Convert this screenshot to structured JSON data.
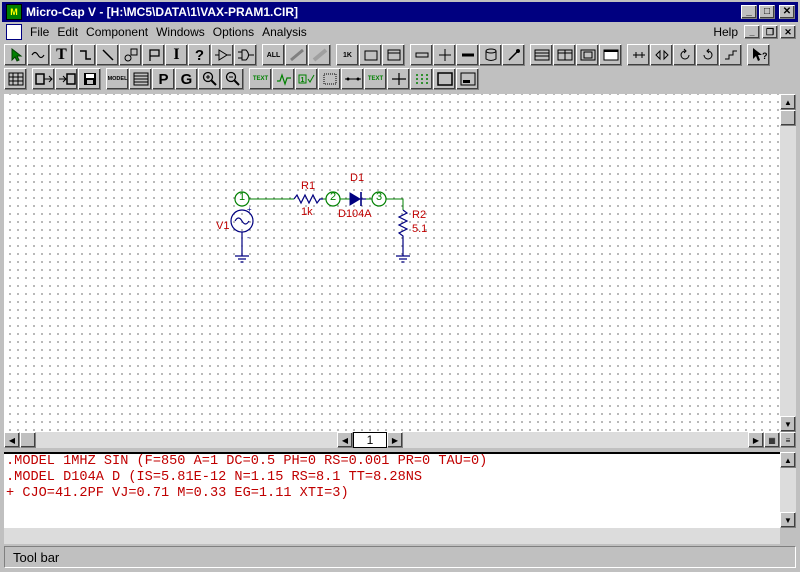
{
  "window": {
    "title": "Micro-Cap V - [H:\\MC5\\DATA\\1\\VAX-PRAM1.CIR]",
    "minimize_glyph": "_",
    "maximize_glyph": "□",
    "close_glyph": "✕"
  },
  "menu": {
    "items": [
      "File",
      "Edit",
      "Component",
      "Windows",
      "Options",
      "Analysis"
    ],
    "help": "Help"
  },
  "toolbar1": {
    "icons": [
      "select-arrow-icon",
      "wire-icon",
      "text-icon",
      "orthogonal-wire-icon",
      "diagonal-wire-icon",
      "flip-icon",
      "flag-icon",
      "info-icon",
      "help-icon",
      "buffer-icon",
      "gate-icon",
      "all-pins-icon",
      "fill-icon",
      "shade-icon",
      "attribute-text-icon",
      "rect-icon",
      "window-icon",
      "line-icon",
      "cross-icon",
      "bus-icon",
      "cylinder-icon",
      "probe-icon",
      "stack-icon",
      "split-icon",
      "split-3-icon",
      "maximize-icon",
      "pin-icon",
      "mirror-icon",
      "rotate-ccw-icon",
      "rotate-cw-icon",
      "step-icon",
      "pointer-help-icon"
    ]
  },
  "toolbar2": {
    "icons": [
      "calculator-icon",
      "save-model-icon",
      "copy-icon",
      "floppy-icon",
      "model-icon",
      "grid-icon",
      "p-icon",
      "g-icon",
      "zoom-in-icon",
      "zoom-out-icon",
      "text-label-icon",
      "waveform-icon",
      "node-number-icon",
      "dot-grid-icon",
      "pin-connect-icon",
      "text-attr-icon",
      "crosshair-icon",
      "grid-dots-icon",
      "frame-icon",
      "window-minimize-icon"
    ],
    "text_badge": "TEXT",
    "model_label": "MODEL"
  },
  "schematic": {
    "nodes": [
      "1",
      "2",
      "3"
    ],
    "components": {
      "v1": {
        "ref": "V1"
      },
      "r1": {
        "ref": "R1",
        "value": "1k"
      },
      "d1": {
        "ref": "D1",
        "value": "D104A"
      },
      "r2": {
        "ref": "R2",
        "value": "5.1"
      }
    }
  },
  "page_tab": "1",
  "text_area": {
    "lines": [
      ".MODEL 1MHZ SIN (F=850 A=1 DC=0.5 PH=0 RS=0.001 PR=0 TAU=0)",
      ".MODEL D104A D (IS=5.81E-12 N=1.15 RS=8.1 TT=8.28NS",
      "+ CJO=41.2PF VJ=0.71 M=0.33 EG=1.11 XTI=3)"
    ]
  },
  "status": "Tool bar",
  "colors": {
    "titlebar": "#000080",
    "node": "#008000",
    "component": "#c00000",
    "diode": "#000080"
  }
}
